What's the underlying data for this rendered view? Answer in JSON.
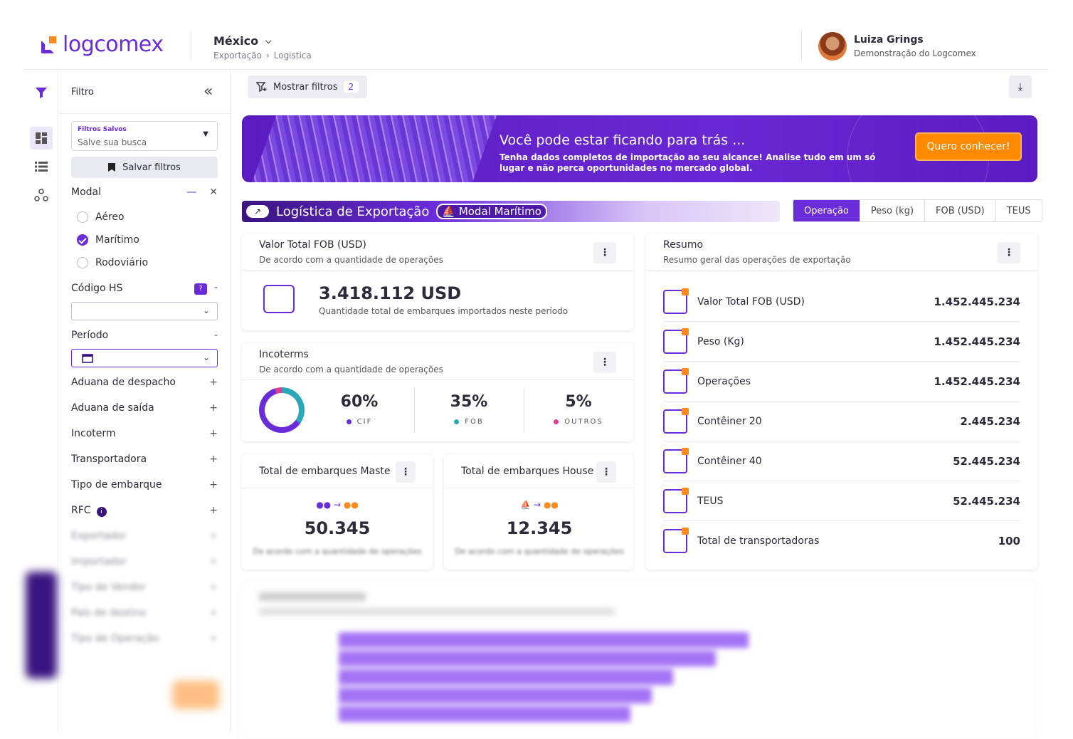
{
  "header": {
    "logo_text": "logcomex",
    "country": "México",
    "breadcrumb": [
      "Exportação",
      "Logistica"
    ],
    "user_name": "Luiza Grings",
    "user_role": "Demonstração do Logcomex"
  },
  "filter": {
    "title": "Filtro",
    "saved_label": "Filtros Salvos",
    "saved_value": "Salve sua busca",
    "save_button": "Salvar filtros",
    "modal_title": "Modal",
    "modal_options": [
      {
        "label": "Aéreo",
        "selected": false
      },
      {
        "label": "Marítimo",
        "selected": true
      },
      {
        "label": "Rodoviário",
        "selected": false
      }
    ],
    "codigo_hs": "Código HS",
    "periodo": "Período",
    "sections": [
      "Aduana de despacho",
      "Aduana de saída",
      "Incoterm",
      "Transportadora",
      "Tipo de embarque",
      "RFC"
    ],
    "blurred_sections": [
      "Exportador",
      "Importador",
      "Tipo de Vendor",
      "País de destino",
      "Tipo de Operação"
    ]
  },
  "toolbar": {
    "show_filters": "Mostrar filtros",
    "filter_count": "2"
  },
  "banner": {
    "headline": "Você pode estar ficando para trás ...",
    "sub": "Tenha dados completos de importação ao seu alcance! Analise tudo em um só lugar e não perca oportunidades no mercado global.",
    "cta": "Quero conhecer!"
  },
  "page": {
    "title": "Logística de Exportação",
    "modal_pill": "Modal Marítimo",
    "segments": [
      "Operação",
      "Peso (kg)",
      "FOB (USD)",
      "TEUS"
    ],
    "active_segment": "Operação"
  },
  "fob_card": {
    "title": "Valor Total FOB (USD)",
    "subtitle": "De acordo com a quantidade de operações",
    "value": "3.418.112 USD",
    "caption": "Quantidade total de embarques importados neste período"
  },
  "incoterms": {
    "title": "Incoterms",
    "subtitle": "De acordo com a quantidade de operações",
    "items": [
      {
        "pct": "60%",
        "key": "CIF",
        "color": "#6a2bd9"
      },
      {
        "pct": "35%",
        "key": "FOB",
        "color": "#2ba8b8"
      },
      {
        "pct": "5%",
        "key": "OUTROS",
        "color": "#e33b8f"
      }
    ]
  },
  "master": {
    "title": "Total de embarques Maste",
    "value": "50.345",
    "sub": "De acordo com a quantidade de operações"
  },
  "house": {
    "title": "Total de embarques House",
    "value": "12.345",
    "sub": "De acordo com a quantidade de operações"
  },
  "resumo": {
    "title": "Resumo",
    "subtitle": "Resumo geral das operações de exportação",
    "rows": [
      {
        "label": "Valor Total FOB (USD)",
        "value": "1.452.445.234"
      },
      {
        "label": "Peso (Kg)",
        "value": "1.452.445.234"
      },
      {
        "label": "Operações",
        "value": "1.452.445.234"
      },
      {
        "label": "Contêiner 20",
        "value": "2.445.234"
      },
      {
        "label": "Contêiner 40",
        "value": "52.445.234"
      },
      {
        "label": "TEUS",
        "value": "52.445.234"
      },
      {
        "label": "Total de transportadoras",
        "value": "100"
      }
    ]
  }
}
